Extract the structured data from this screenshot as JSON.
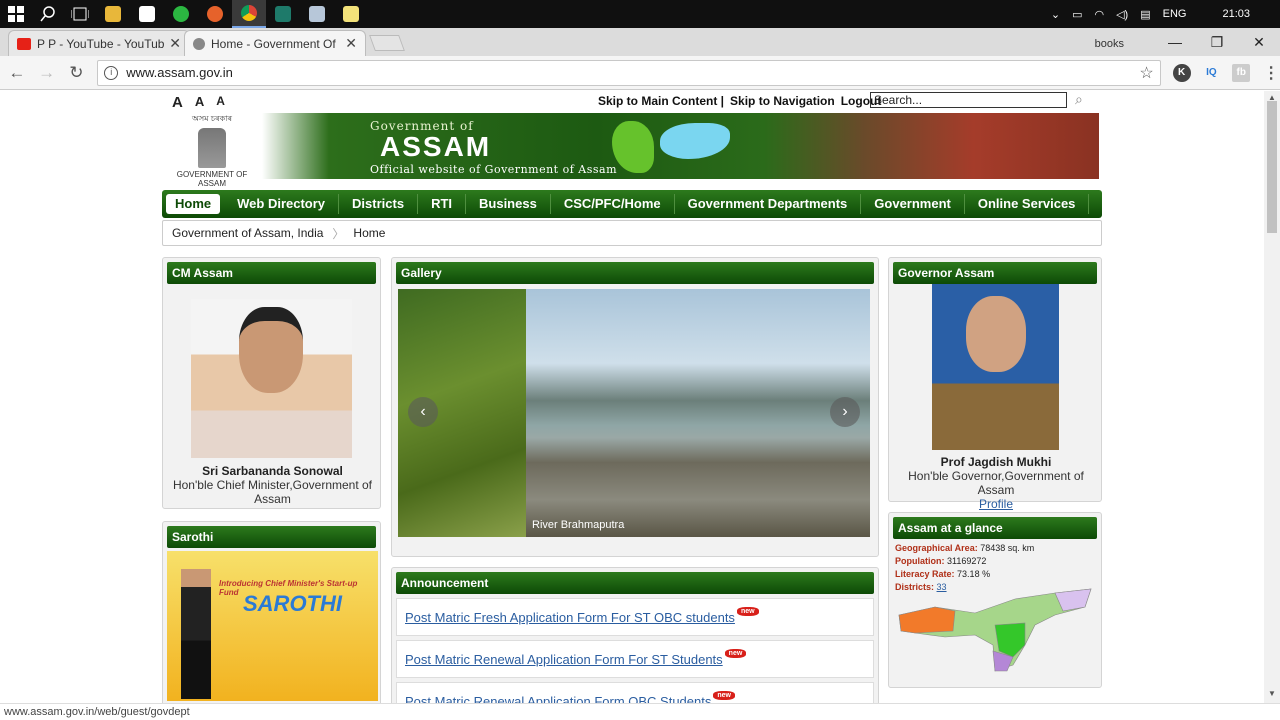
{
  "taskbar": {
    "language": "ENG",
    "time": "21:03"
  },
  "browser": {
    "tabs": [
      {
        "title": "P P - YouTube - YouTube",
        "active": false,
        "favicon_color": "#e62117"
      },
      {
        "title": "Home - Government Of",
        "active": true,
        "favicon_color": "#666666"
      }
    ],
    "profile_label": "books",
    "url": "www.assam.gov.in",
    "extensions": [
      "K",
      "IQ",
      "fb"
    ],
    "status_url": "www.assam.gov.in/web/guest/govdept"
  },
  "page": {
    "font_controls": [
      "A",
      "A",
      "A"
    ],
    "top_links": [
      "Skip to Main Content |",
      "Skip to Navigation",
      "Logout"
    ],
    "search_placeholder": "Search...",
    "emblem_script": "অসম চৰকাৰ",
    "emblem_label": "GOVERNMENT OF ASSAM",
    "banner": {
      "gov_of": "Government of",
      "state": "ASSAM",
      "tagline": "Official website of Government of Assam"
    },
    "nav": [
      "Home",
      "Web Directory",
      "Districts",
      "RTI",
      "Business",
      "CSC/PFC/Home",
      "Government Departments",
      "Government",
      "Online Services"
    ],
    "breadcrumb": [
      "Government of Assam, India",
      "Home"
    ],
    "cm": {
      "heading": "CM Assam",
      "name": "Sri Sarbananda Sonowal",
      "title": "Hon'ble Chief Minister,Government of Assam"
    },
    "sarothi": {
      "heading": "Sarothi",
      "tag": "Introducing Chief Minister's Start-up Fund",
      "brand": "SAROTHI"
    },
    "gallery": {
      "heading": "Gallery",
      "caption": "River Brahmaputra"
    },
    "announcement": {
      "heading": "Announcement",
      "badge": "new",
      "items": [
        "Post Matric Fresh Application Form For ST OBC students",
        "Post Matric Renewal Application Form For ST Students",
        "Post Matric Renewal Application Form OBC Students"
      ]
    },
    "governor": {
      "heading": "Governor Assam",
      "name": "Prof Jagdish Mukhi",
      "title": "Hon'ble Governor,Government of Assam",
      "link": "Profile"
    },
    "glance": {
      "heading": "Assam at a glance",
      "area_label": "Geographical Area:",
      "area_value": "78438 sq. km",
      "pop_label": "Population:",
      "pop_value": "31169272",
      "lit_label": "Literacy Rate:",
      "lit_value": "73.18 %",
      "dist_label": "Districts:",
      "dist_value": "33"
    }
  }
}
